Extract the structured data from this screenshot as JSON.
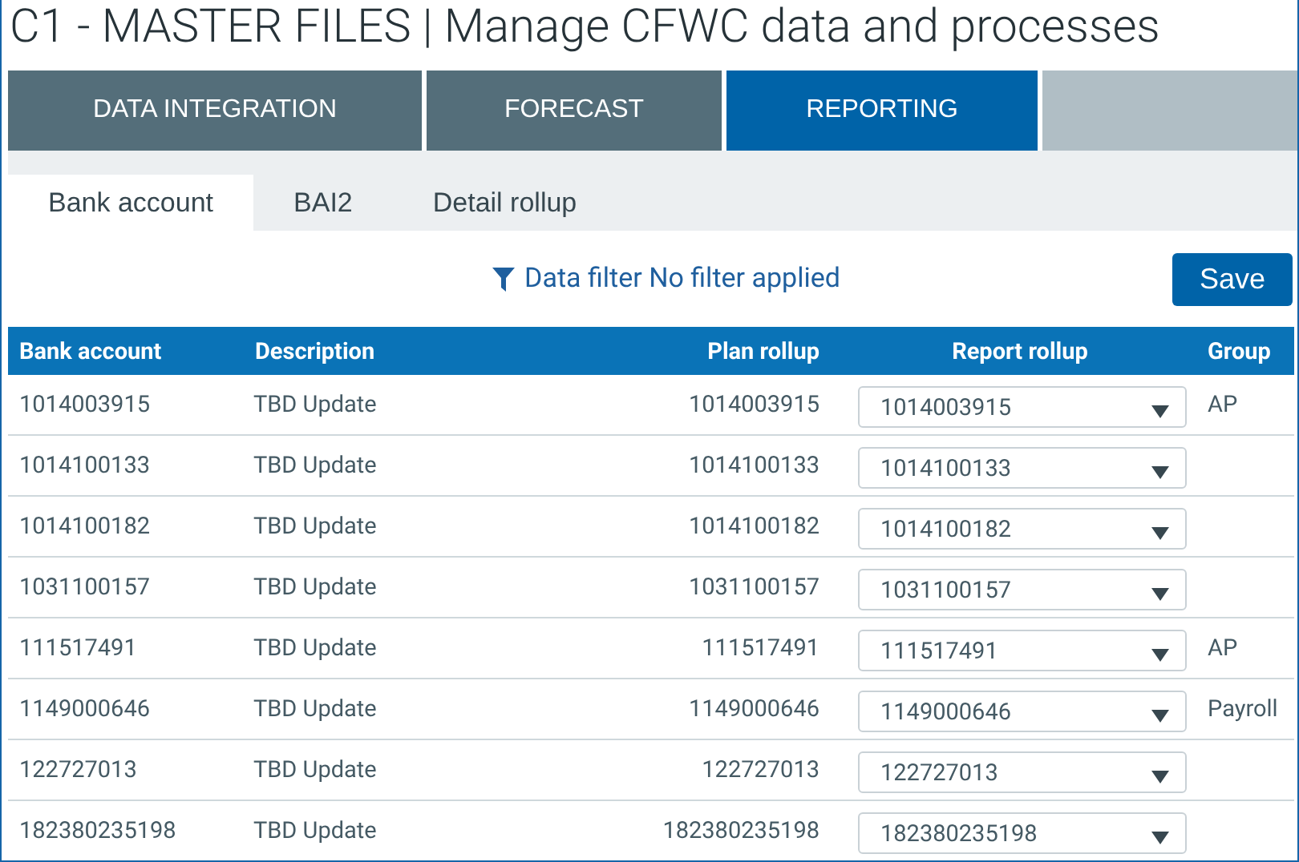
{
  "title": "C1 - MASTER FILES | Manage CFWC data and processes",
  "nav_tabs": [
    {
      "label": "DATA INTEGRATION",
      "selected": false
    },
    {
      "label": "FORECAST",
      "selected": false
    },
    {
      "label": "REPORTING",
      "selected": true
    }
  ],
  "sub_tabs": [
    {
      "label": "Bank account",
      "selected": true
    },
    {
      "label": "BAI2",
      "selected": false
    },
    {
      "label": "Detail rollup",
      "selected": false
    }
  ],
  "filter": {
    "label": "Data filter",
    "value": "No filter applied"
  },
  "save_button": "Save",
  "table": {
    "columns": [
      "Bank account",
      "Description",
      "Plan rollup",
      "Report rollup",
      "Group"
    ],
    "rows": [
      {
        "bank_account": "1014003915",
        "description": "TBD Update",
        "plan_rollup": "1014003915",
        "report_rollup": "1014003915",
        "group": "AP"
      },
      {
        "bank_account": "1014100133",
        "description": "TBD Update",
        "plan_rollup": "1014100133",
        "report_rollup": "1014100133",
        "group": ""
      },
      {
        "bank_account": "1014100182",
        "description": "TBD Update",
        "plan_rollup": "1014100182",
        "report_rollup": "1014100182",
        "group": ""
      },
      {
        "bank_account": "1031100157",
        "description": "TBD Update",
        "plan_rollup": "1031100157",
        "report_rollup": "1031100157",
        "group": ""
      },
      {
        "bank_account": "111517491",
        "description": "TBD Update",
        "plan_rollup": "111517491",
        "report_rollup": "111517491",
        "group": "AP"
      },
      {
        "bank_account": "1149000646",
        "description": "TBD Update",
        "plan_rollup": "1149000646",
        "report_rollup": "1149000646",
        "group": "Payroll"
      },
      {
        "bank_account": "122727013",
        "description": "TBD Update",
        "plan_rollup": "122727013",
        "report_rollup": "122727013",
        "group": ""
      },
      {
        "bank_account": "182380235198",
        "description": "TBD Update",
        "plan_rollup": "182380235198",
        "report_rollup": "182380235198",
        "group": ""
      }
    ]
  }
}
